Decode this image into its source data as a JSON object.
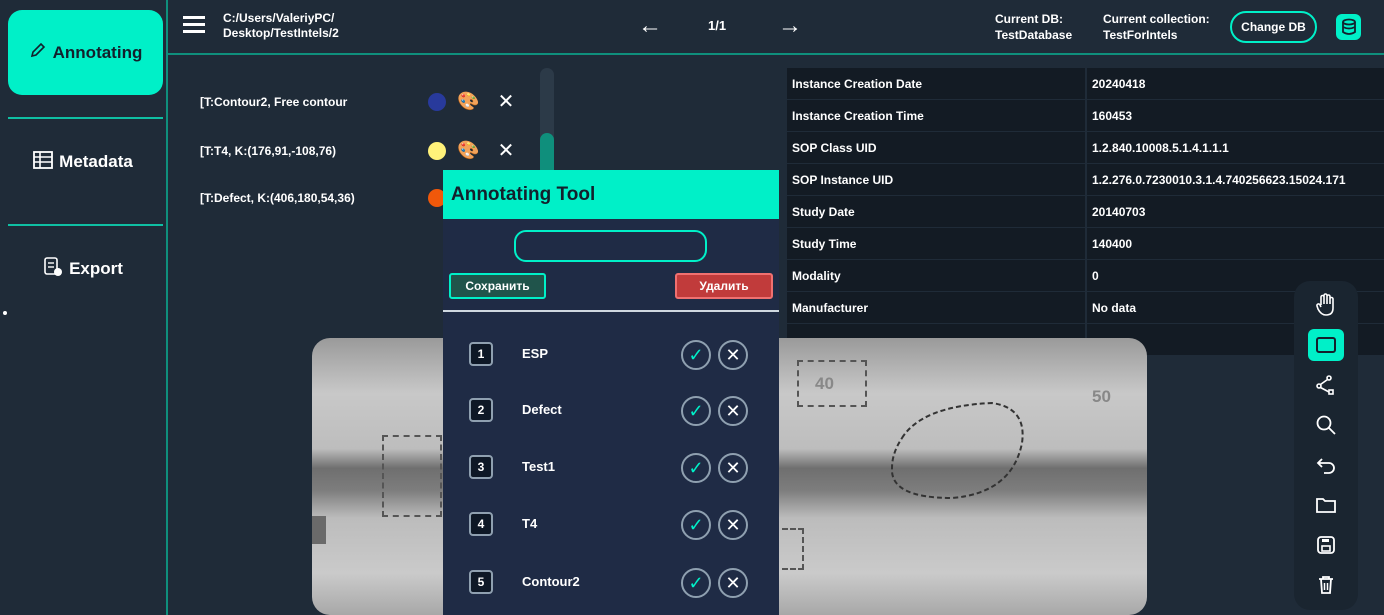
{
  "sidebar": {
    "items": [
      {
        "label": "Annotating",
        "icon": "pencil-icon"
      },
      {
        "label": "Metadata",
        "icon": "table-icon"
      },
      {
        "label": "Export",
        "icon": "export-icon"
      }
    ]
  },
  "header": {
    "path_line1": "C:/Users/ValeriyPC/",
    "path_line2": "Desktop/TestIntels/2",
    "pager": "1/1",
    "db_label": "Current DB:",
    "db_value": "TestDatabase",
    "collection_label": "Current collection:",
    "collection_value": "TestForIntels",
    "change_db": "Change DB"
  },
  "annotations": [
    {
      "label": "[T:Contour2, Free contour",
      "color": "#283a9c"
    },
    {
      "label": "[T:T4, K:(176,91,-108,76)",
      "color": "#fff27a"
    },
    {
      "label": "[T:Defect, K:(406,180,54,36)",
      "color": "#f0580a"
    }
  ],
  "metadata": [
    {
      "key": "Instance Creation Date",
      "value": "20240418"
    },
    {
      "key": "Instance Creation Time",
      "value": "160453"
    },
    {
      "key": "SOP Class UID",
      "value": "1.2.840.10008.5.1.4.1.1.1"
    },
    {
      "key": "SOP Instance UID",
      "value": "1.2.276.0.7230010.3.1.4.740256623.15024.171"
    },
    {
      "key": "Study Date",
      "value": "20140703"
    },
    {
      "key": "Study Time",
      "value": "140400"
    },
    {
      "key": "Modality",
      "value": "0"
    },
    {
      "key": "Manufacturer",
      "value": "No data"
    }
  ],
  "tool": {
    "title": "Annotating Tool",
    "save": "Сохранить",
    "delete": "Удалить",
    "classes": [
      {
        "num": "1",
        "name": "ESP"
      },
      {
        "num": "2",
        "name": "Defect"
      },
      {
        "num": "3",
        "name": "Test1"
      },
      {
        "num": "4",
        "name": "T4"
      },
      {
        "num": "5",
        "name": "Contour2"
      }
    ]
  },
  "image": {
    "marker_a": "40",
    "marker_b": "50"
  },
  "colors": {
    "accent": "#00f0c8",
    "background": "#1f2b38",
    "danger": "#c13b3b"
  }
}
